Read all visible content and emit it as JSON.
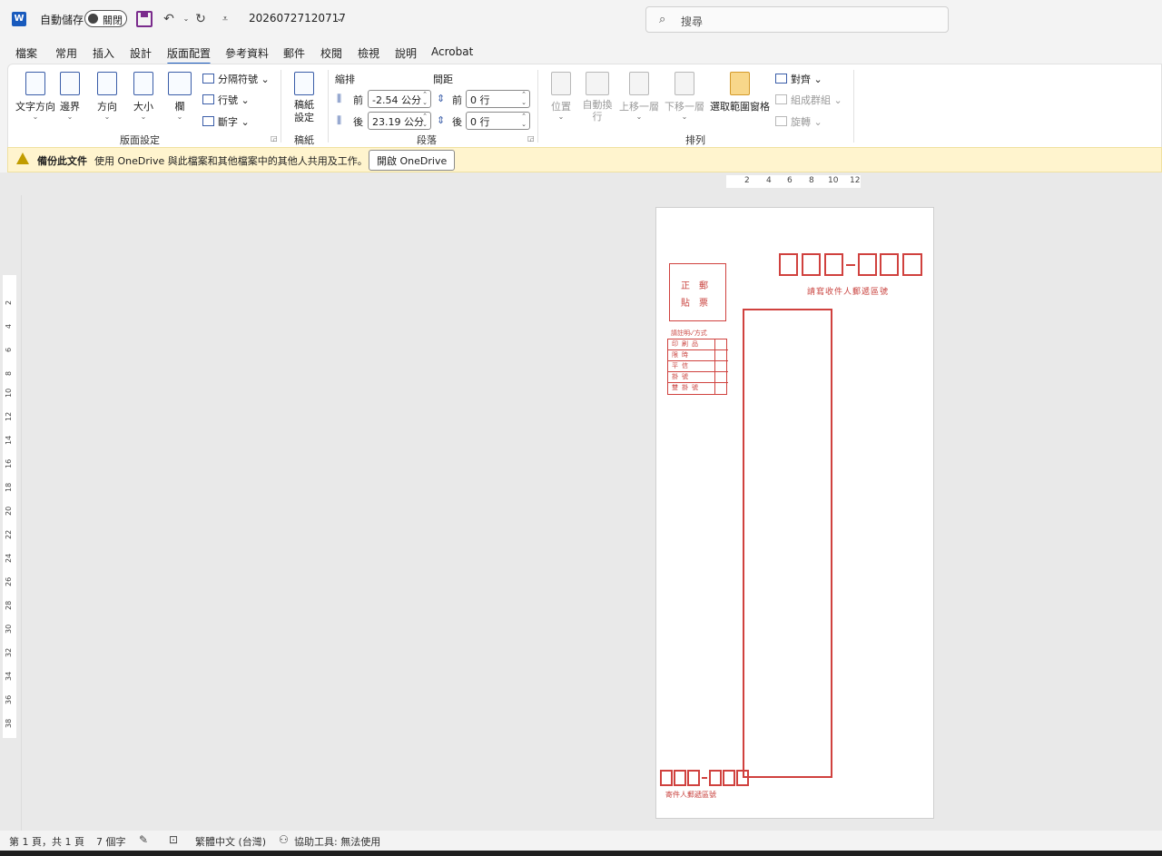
{
  "titlebar": {
    "autosave_label": "自動儲存",
    "toggle_label": "關閉",
    "doc_title": "20260727120717",
    "search_placeholder": "搜尋"
  },
  "tabs": [
    "檔案",
    "常用",
    "插入",
    "設計",
    "版面配置",
    "參考資料",
    "郵件",
    "校閱",
    "檢視",
    "說明",
    "Acrobat"
  ],
  "active_tab": "版面配置",
  "ribbon": {
    "page_setup": {
      "text_direction": "文字方向",
      "margins": "邊界",
      "orientation": "方向",
      "size": "大小",
      "columns": "欄",
      "breaks": "分隔符號",
      "line_numbers": "行號",
      "hyphenation": "斷字",
      "group_label": "版面設定"
    },
    "manuscript": {
      "button": "稿紙設定",
      "group_label": "稿紙"
    },
    "paragraph": {
      "indent_label": "縮排",
      "spacing_label": "間距",
      "indent_before_label": "前",
      "indent_before_value": "-2.54 公分",
      "indent_after_label": "後",
      "indent_after_value": "23.19 公分",
      "spacing_before_label": "前",
      "spacing_before_value": "0 行",
      "spacing_after_label": "後",
      "spacing_after_value": "0 行",
      "group_label": "段落"
    },
    "arrange": {
      "position": "位置",
      "wrap_text": "自動換行",
      "bring_forward": "上移一層",
      "send_backward": "下移一層",
      "selection_pane": "選取範圍窗格",
      "align": "對齊",
      "group": "組成群組",
      "rotate": "旋轉",
      "group_label": "排列"
    }
  },
  "infobar": {
    "bold_text": "備份此文件",
    "message": "使用 OneDrive 與此檔案和其他檔案中的其他人共用及工作。",
    "button": "開啟 OneDrive"
  },
  "ruler": {
    "horizontal": [
      "2",
      "4",
      "6",
      "8",
      "10",
      "12"
    ],
    "vertical": [
      "2",
      "4",
      "6",
      "8",
      "10",
      "12",
      "14",
      "16",
      "18",
      "20",
      "22",
      "24",
      "26",
      "28",
      "30",
      "32",
      "34",
      "36",
      "38"
    ]
  },
  "envelope": {
    "recipient_zip_caption": "請寫收件人郵遞區號",
    "stamp_line1": "正　郵",
    "stamp_line2": "貼　票",
    "mail_type_caption": "請註明✓方式",
    "mail_types": [
      "印刷品",
      "限時",
      "平信",
      "掛號",
      "雙掛號"
    ],
    "sender_zip_caption": "寄件人郵遞區號",
    "red_color": "#d0413e"
  },
  "statusbar": {
    "page": "第 1 頁，共 1 頁",
    "words": "7 個字",
    "language": "繁體中文 (台灣)",
    "accessibility": "協助工具: 無法使用"
  }
}
